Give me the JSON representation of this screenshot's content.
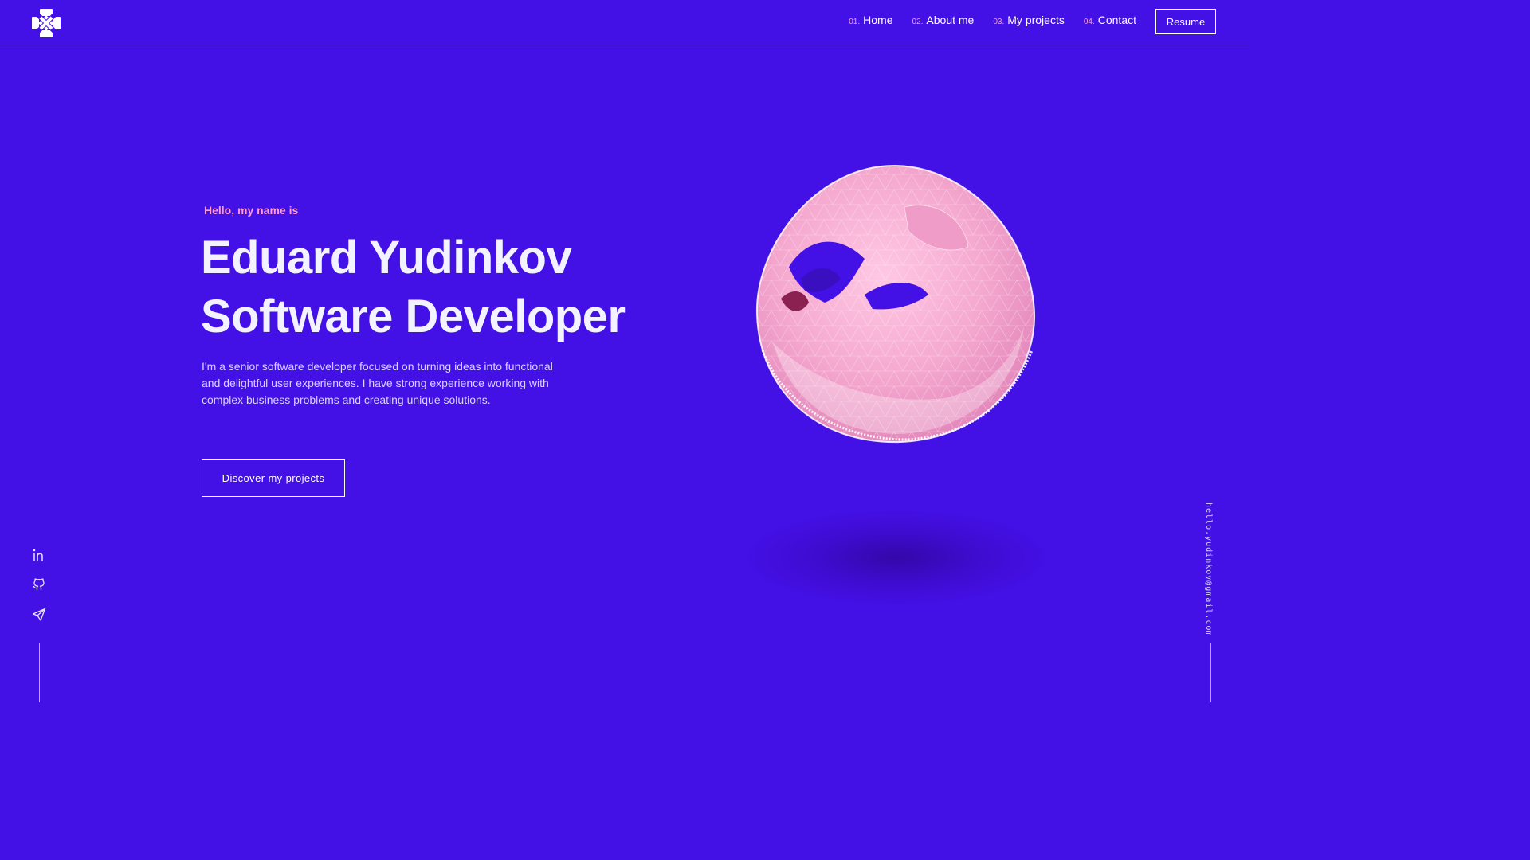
{
  "header": {
    "logo": "brand-logo-icon",
    "nav": [
      {
        "num": "01.",
        "label": "Home"
      },
      {
        "num": "02.",
        "label": "About me"
      },
      {
        "num": "03.",
        "label": "My projects"
      },
      {
        "num": "04.",
        "label": "Contact"
      }
    ],
    "resume_label": "Resume"
  },
  "hero": {
    "greeting": "Hello, my name is",
    "name": "Eduard Yudinkov",
    "role": "Software Developer",
    "intro": "I'm a senior software developer focused on turning ideas into functional and delightful user experiences. I have strong experience working with complex business problems and creating unique solutions.",
    "cta_label": "Discover my projects"
  },
  "side": {
    "socials": [
      "linkedin-icon",
      "github-icon",
      "telegram-icon"
    ],
    "email": "hello.yudinkov@gmail.com"
  },
  "colors": {
    "background": "#4310e6",
    "accent": "#ff9cd9",
    "sphere": "#f5a9cf",
    "text": "#ffffff"
  }
}
